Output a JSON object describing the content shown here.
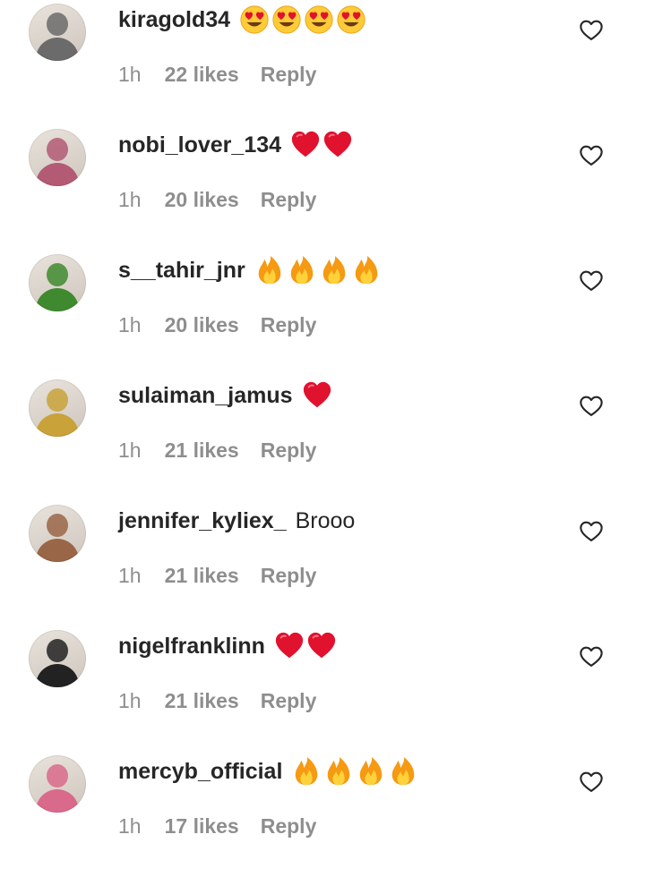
{
  "comments": [
    {
      "username": "kiragold34",
      "text": "",
      "emojis": [
        "heart-eyes",
        "heart-eyes",
        "heart-eyes",
        "heart-eyes"
      ],
      "time": "1h",
      "likes": "22 likes",
      "reply": "Reply",
      "avatar_color": "#6b6b6b"
    },
    {
      "username": "nobi_lover_134",
      "text": "",
      "emojis": [
        "red-heart",
        "red-heart"
      ],
      "time": "1h",
      "likes": "20 likes",
      "reply": "Reply",
      "avatar_color": "#b35a74"
    },
    {
      "username": "s__tahir_jnr",
      "text": "",
      "emojis": [
        "fire",
        "fire",
        "fire",
        "fire"
      ],
      "time": "1h",
      "likes": "20 likes",
      "reply": "Reply",
      "avatar_color": "#3f8a2f"
    },
    {
      "username": "sulaiman_jamus",
      "text": "",
      "emojis": [
        "red-heart"
      ],
      "time": "1h",
      "likes": "21 likes",
      "reply": "Reply",
      "avatar_color": "#c9a23a"
    },
    {
      "username": "jennifer_kyliex_",
      "text": "Brooo",
      "emojis": [],
      "time": "1h",
      "likes": "21 likes",
      "reply": "Reply",
      "avatar_color": "#9a6648"
    },
    {
      "username": "nigelfranklinn",
      "text": "",
      "emojis": [
        "red-heart",
        "red-heart"
      ],
      "time": "1h",
      "likes": "21 likes",
      "reply": "Reply",
      "avatar_color": "#222222"
    },
    {
      "username": "mercyb_official",
      "text": "",
      "emojis": [
        "fire",
        "fire",
        "fire",
        "fire"
      ],
      "time": "1h",
      "likes": "17 likes",
      "reply": "Reply",
      "avatar_color": "#d96a8b"
    }
  ],
  "icons": {
    "like": "heart-outline-icon"
  },
  "colors": {
    "text": "#262626",
    "secondary": "#8e8e8e",
    "heart": "#e0122e",
    "fire": "#f59a12",
    "emoji_face": "#ffcb36"
  }
}
